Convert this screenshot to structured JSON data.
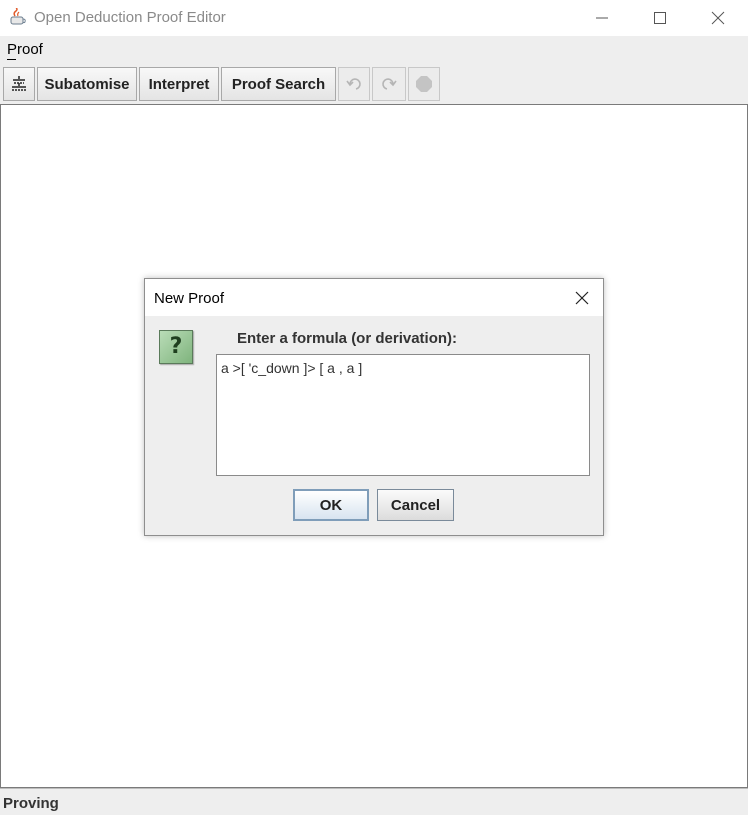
{
  "window": {
    "title": "Open Deduction Proof Editor"
  },
  "menubar": {
    "items": [
      {
        "label": "Proof",
        "mnemonic": "P"
      }
    ]
  },
  "toolbar": {
    "layout_icon": "tree-layout-icon",
    "subatomise_label": "Subatomise",
    "interpret_label": "Interpret",
    "proof_search_label": "Proof Search",
    "undo_icon": "undo-icon",
    "redo_icon": "redo-icon",
    "stop_icon": "stop-icon"
  },
  "statusbar": {
    "text": "Proving"
  },
  "dialog": {
    "title": "New Proof",
    "icon": "question-icon",
    "prompt": "Enter a formula (or derivation):",
    "formula_value": "a >[ 'c_down ]> [ a , a ]",
    "ok_label": "OK",
    "cancel_label": "Cancel"
  },
  "colors": {
    "toolbar_bg": "#eeeeee",
    "question_icon_green": "#8fc08d",
    "default_button_border": "#7f9db9"
  }
}
